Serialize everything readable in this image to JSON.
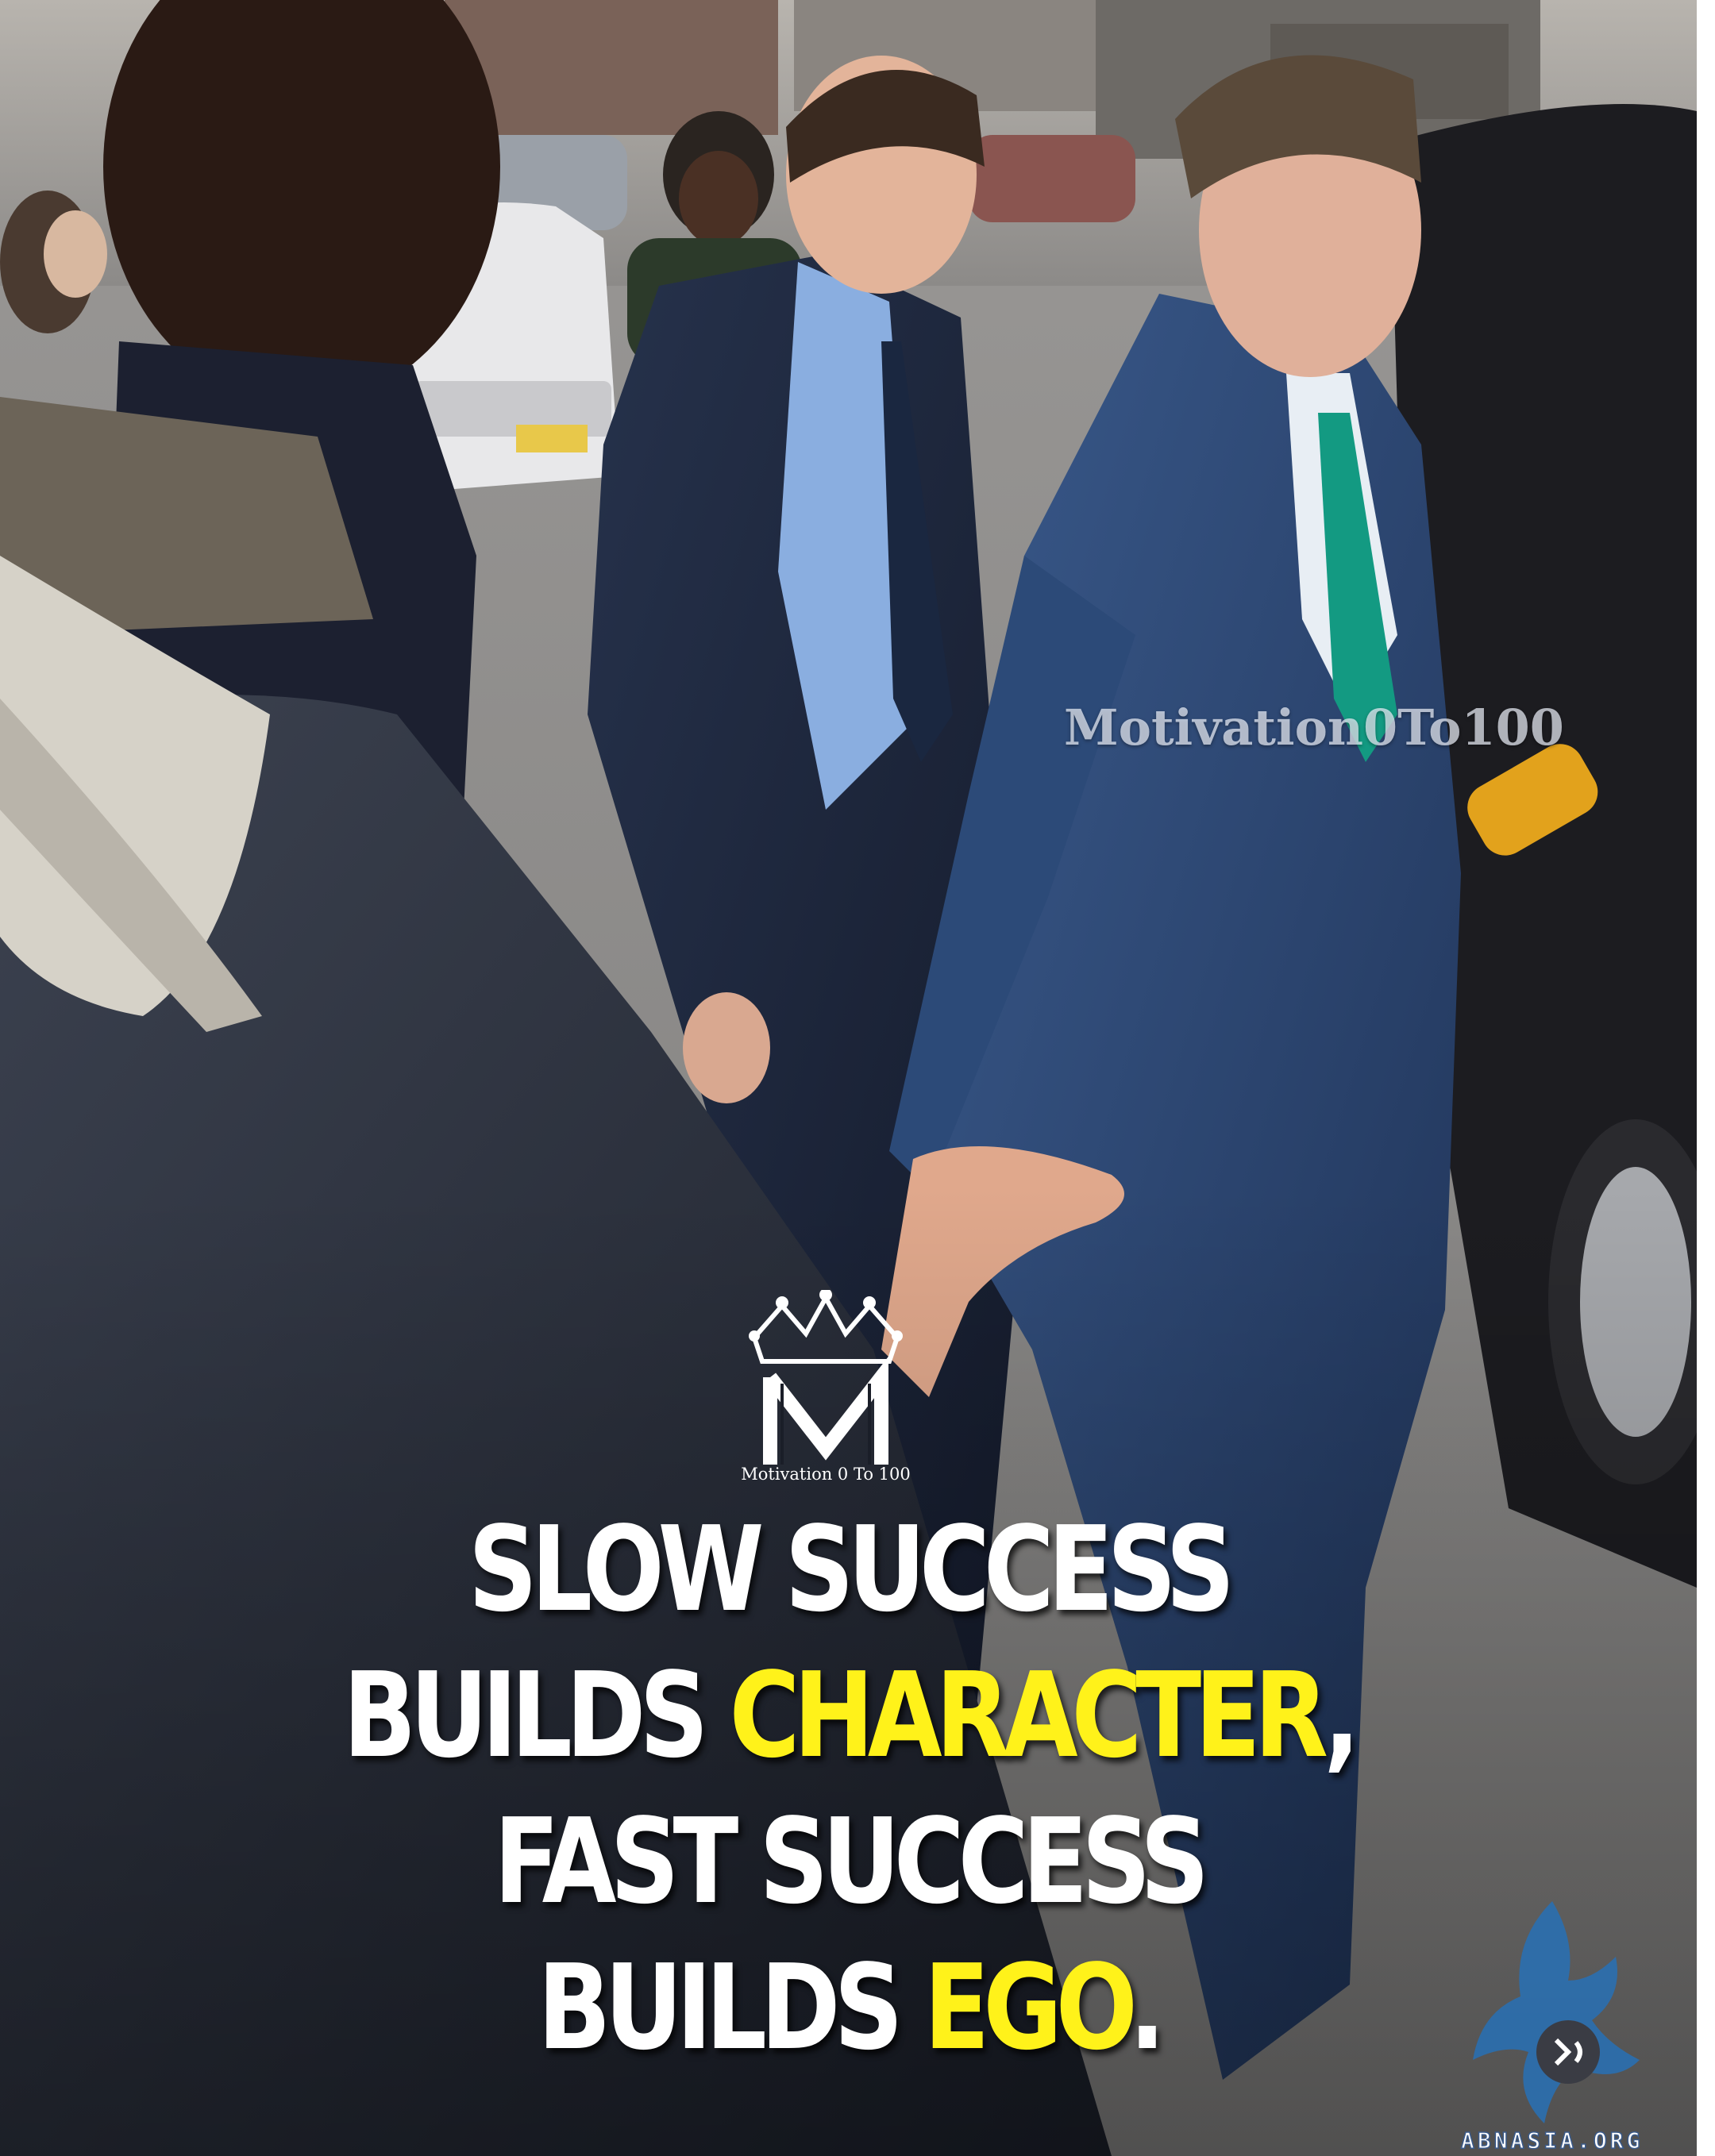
{
  "photo": {
    "description_icon": "street-scene-photo-icon"
  },
  "watermark": "Motivation0To100",
  "logo": {
    "letter": "M",
    "caption": "Motivation 0 To 100"
  },
  "quote": {
    "line1": "SLOW SUCCESS",
    "line2_prefix": "BUILDS ",
    "line2_highlight": "CHARACTER",
    "line2_suffix": ",",
    "line3": "FAST SUCCESS",
    "line4_prefix": "BUILDS ",
    "line4_highlight": "EGO",
    "line4_suffix": "."
  },
  "corner": {
    "site": "ABNASIA.ORG"
  },
  "colors": {
    "highlight": "#fff21a",
    "text": "#ffffff"
  }
}
